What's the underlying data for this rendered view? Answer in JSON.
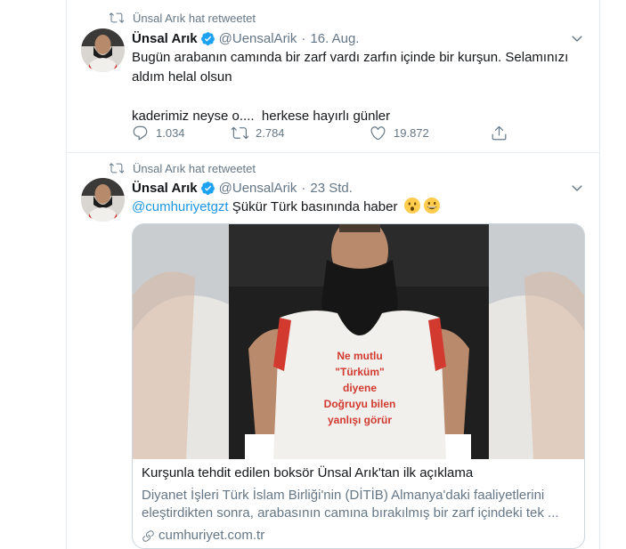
{
  "tweets": [
    {
      "retweet_label": "Ünsal Arık hat retweetet",
      "name": "Ünsal Arık",
      "handle": "@UensalArik",
      "separator": "·",
      "time": "16. Aug.",
      "text_line1": "Bugün arabanın camında bir zarf vardı zarfın içinde bir kurşun. Selamınızı",
      "text_line2": "aldım helal olsun",
      "text_line3": "kaderimiz neyse o....  herkese hayırlı günler",
      "replies": "1.034",
      "retweets": "2.784",
      "likes": "19.872"
    },
    {
      "retweet_label": "Ünsal Arık hat retweetet",
      "name": "Ünsal Arık",
      "handle": "@UensalArik",
      "separator": "·",
      "time": "23 Std.",
      "mention": "@cumhuriyetgzt",
      "text": " Şükür Türk basınında haber ",
      "card": {
        "shirt_line1": "Ne mutlu",
        "shirt_line2": "\"Türküm\"",
        "shirt_line3": "diyene",
        "shirt_line4": "Doğruyu bilen",
        "shirt_line5": "yanlışı görür",
        "title": "Kurşunla tehdit edilen boksör Ünsal Arık'tan ilk açıklama",
        "desc_line1": "Diyanet İşleri Türk İslam Birliği'nin (DİTİB) Almanya'daki faaliyetlerini",
        "desc_line2": "eleştirdikten sonra, arabasının camına bırakılmış bir zarf içindeki tek ...",
        "domain": "cumhuriyet.com.tr"
      }
    }
  ],
  "colors": {
    "accent": "#1da1f2",
    "link": "#1b95e0",
    "secondary_text": "#657786",
    "border": "#e6ecf0"
  },
  "icons": [
    "retweet-icon",
    "verified-badge-icon",
    "chevron-down-icon",
    "reply-icon",
    "like-icon",
    "share-icon",
    "link-icon",
    "hushed-face-emoji",
    "grinning-face-emoji"
  ]
}
